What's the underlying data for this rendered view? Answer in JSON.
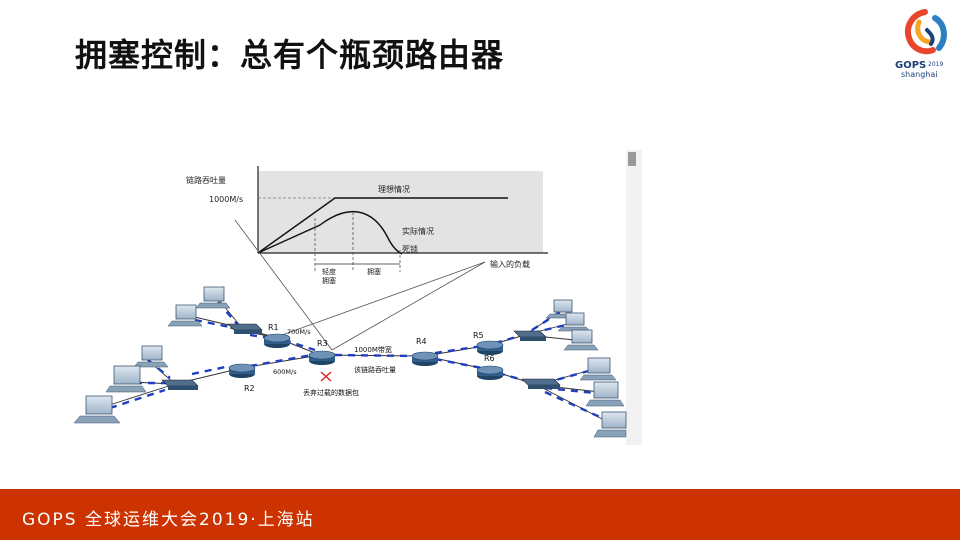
{
  "slide": {
    "title": "拥塞控制：总有个瓶颈路由器",
    "footer": "GOPS 全球运维大会2019·上海站"
  },
  "logo": {
    "brand": "GOPS",
    "year": "2019",
    "city": "shanghai",
    "colors": [
      "#e8452c",
      "#f5a623",
      "#2d7fc1",
      "#1b3f7a"
    ]
  },
  "diagram": {
    "throughput_chart": {
      "y_axis_label": "链路吞吐量",
      "y_tick": "1000M/s",
      "x_axis_label": "输入的负载",
      "ideal_label": "理想情况",
      "actual_label": "实际情况",
      "deadlock_label": "死锁",
      "light_congestion_label": "轻度\n拥塞",
      "light_line1": "轻度",
      "light_line2": "拥塞",
      "congestion_label": "拥塞"
    },
    "network": {
      "routers": [
        "R1",
        "R2",
        "R3",
        "R4",
        "R5",
        "R6"
      ],
      "r1_rate": "700M/s",
      "r2_rate": "600M/s",
      "bandwidth_label": "1000M带宽",
      "link_throughput_label": "该链路吞吐量",
      "drop_label": "丢弃过载的数据包"
    }
  },
  "colors": {
    "footer_bg": "#cc3300",
    "router_blue": "#2f5f8a",
    "packet_blue": "#1f3fbf",
    "drop_red": "#d81e1e"
  }
}
